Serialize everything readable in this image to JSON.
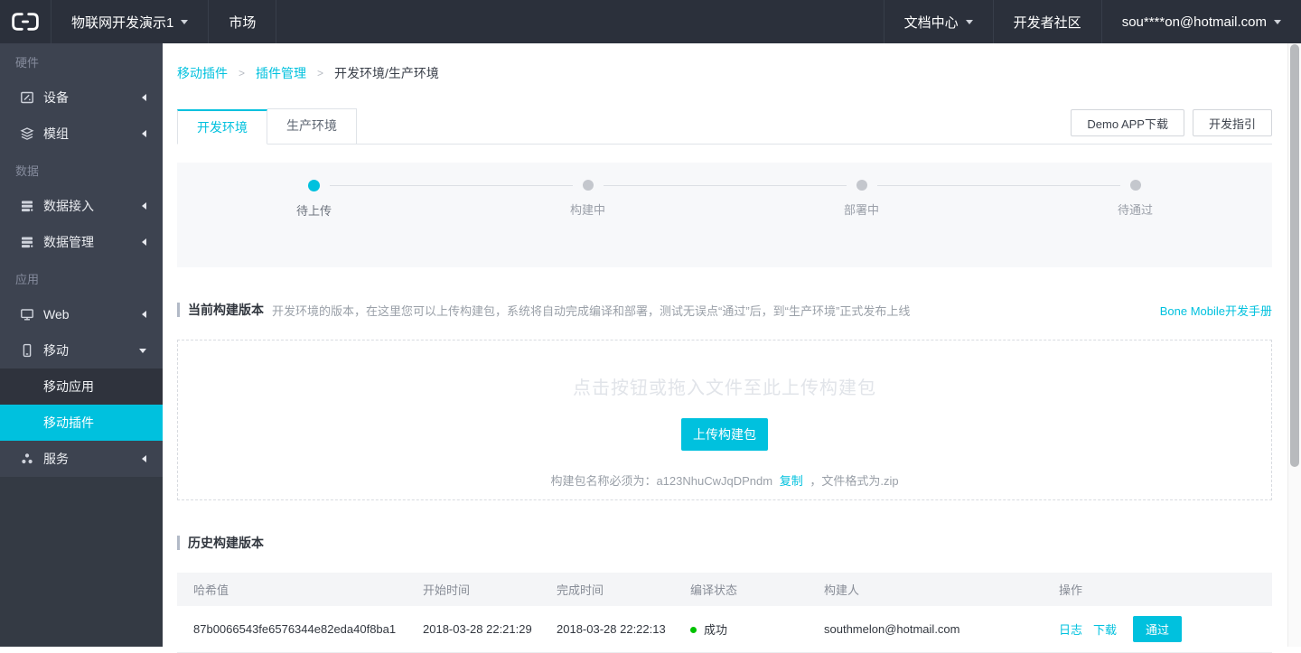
{
  "colors": {
    "accent": "#00c1de",
    "success": "#00c200",
    "topnav_bg": "#2b303b",
    "sidebar_bg": "#3d4350"
  },
  "nav": {
    "project": "物联网开发演示1",
    "market": "市场",
    "doc_center": "文档中心",
    "community": "开发者社区",
    "user_email": "sou****on@hotmail.com"
  },
  "sidebar": {
    "section_hardware": "硬件",
    "item_device": "设备",
    "item_module": "模组",
    "section_data": "数据",
    "item_data_access": "数据接入",
    "item_data_manage": "数据管理",
    "section_app": "应用",
    "item_web": "Web",
    "item_mobile": "移动",
    "item_mobile_app": "移动应用",
    "item_mobile_plugin": "移动插件",
    "item_service": "服务"
  },
  "breadcrumb": {
    "items": [
      "移动插件",
      "插件管理",
      "开发环境/生产环境"
    ],
    "separator": ">"
  },
  "tabs": {
    "dev": "开发环境",
    "prod": "生产环境"
  },
  "toolbar": {
    "demo_btn": "Demo APP下载",
    "guide_btn": "开发指引"
  },
  "stepper": {
    "steps": [
      {
        "label": "待上传",
        "state": "active"
      },
      {
        "label": "构建中",
        "state": "pending"
      },
      {
        "label": "部署中",
        "state": "pending"
      },
      {
        "label": "待通过",
        "state": "pending"
      }
    ]
  },
  "current_build": {
    "title": "当前构建版本",
    "desc": "开发环境的版本，在这里您可以上传构建包，系统将自动完成编译和部署，测试无误点“通过”后，到“生产环境”正式发布上线",
    "manual_link": "Bone Mobile开发手册"
  },
  "upload": {
    "hint": "点击按钮或拖入文件至此上传构建包",
    "button": "上传构建包",
    "name_text": "构建包名称必须为：a123NhuCwJqDPndm",
    "copy_link": "复制",
    "format_text": "，文件格式为.zip"
  },
  "history": {
    "title": "历史构建版本",
    "headers": [
      "哈希值",
      "开始时间",
      "完成时间",
      "编译状态",
      "构建人",
      "操作"
    ],
    "rows": [
      {
        "hash": "87b0066543fe6576344e82eda40f8ba1",
        "start_time": "2018-03-28 22:21:29",
        "finish_time": "2018-03-28 22:22:13",
        "status": "成功",
        "status_state": "success",
        "builder": "southmelon@hotmail.com",
        "action_log": "日志",
        "action_download": "下载",
        "action_pass": "通过"
      }
    ]
  }
}
